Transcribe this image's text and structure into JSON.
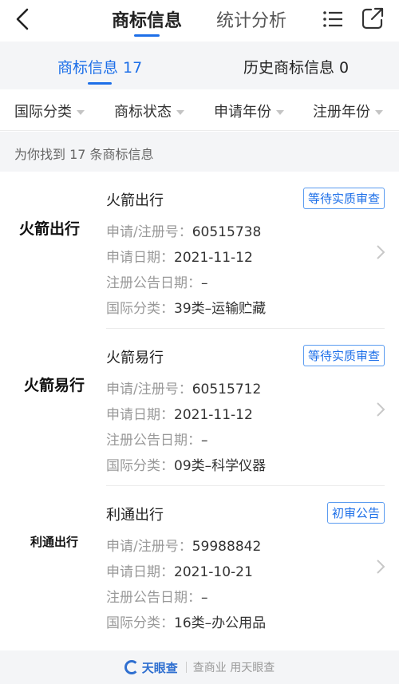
{
  "header": {
    "tabs": [
      {
        "label": "商标信息",
        "active": true
      },
      {
        "label": "统计分析",
        "active": false
      }
    ],
    "icons": [
      "back-arrow-icon",
      "menu-icon",
      "share-icon"
    ],
    "accent_color": "#1d6fe8"
  },
  "subtabs": [
    {
      "label": "商标信息 17",
      "active": true
    },
    {
      "label": "历史商标信息 0",
      "active": false
    }
  ],
  "filters": [
    "国际分类",
    "商标状态",
    "申请年份",
    "注册年份"
  ],
  "found_text": "为你找到 17 条商标信息",
  "field_labels": {
    "reg_no": "申请/注册号：",
    "apply_date": "申请日期：",
    "announce_date": "注册公告日期：",
    "intl_class": "国际分类："
  },
  "trademarks": [
    {
      "logo_text": "火箭出行",
      "name": "火箭出行",
      "status": "等待实质审查",
      "reg_no": "60515738",
      "apply_date": "2021-11-12",
      "announce_date": "–",
      "intl_class": "39类–运输贮藏"
    },
    {
      "logo_text": "火箭易行",
      "name": "火箭易行",
      "status": "等待实质审查",
      "reg_no": "60515712",
      "apply_date": "2021-11-12",
      "announce_date": "–",
      "intl_class": "09类–科学仪器"
    },
    {
      "logo_text": "利通出行",
      "name": "利通出行",
      "status": "初审公告",
      "reg_no": "59988842",
      "apply_date": "2021-10-21",
      "announce_date": "–",
      "intl_class": "16类–办公用品"
    }
  ],
  "footer": {
    "brand": "天眼查",
    "slogan": "查商业 用天眼查"
  }
}
